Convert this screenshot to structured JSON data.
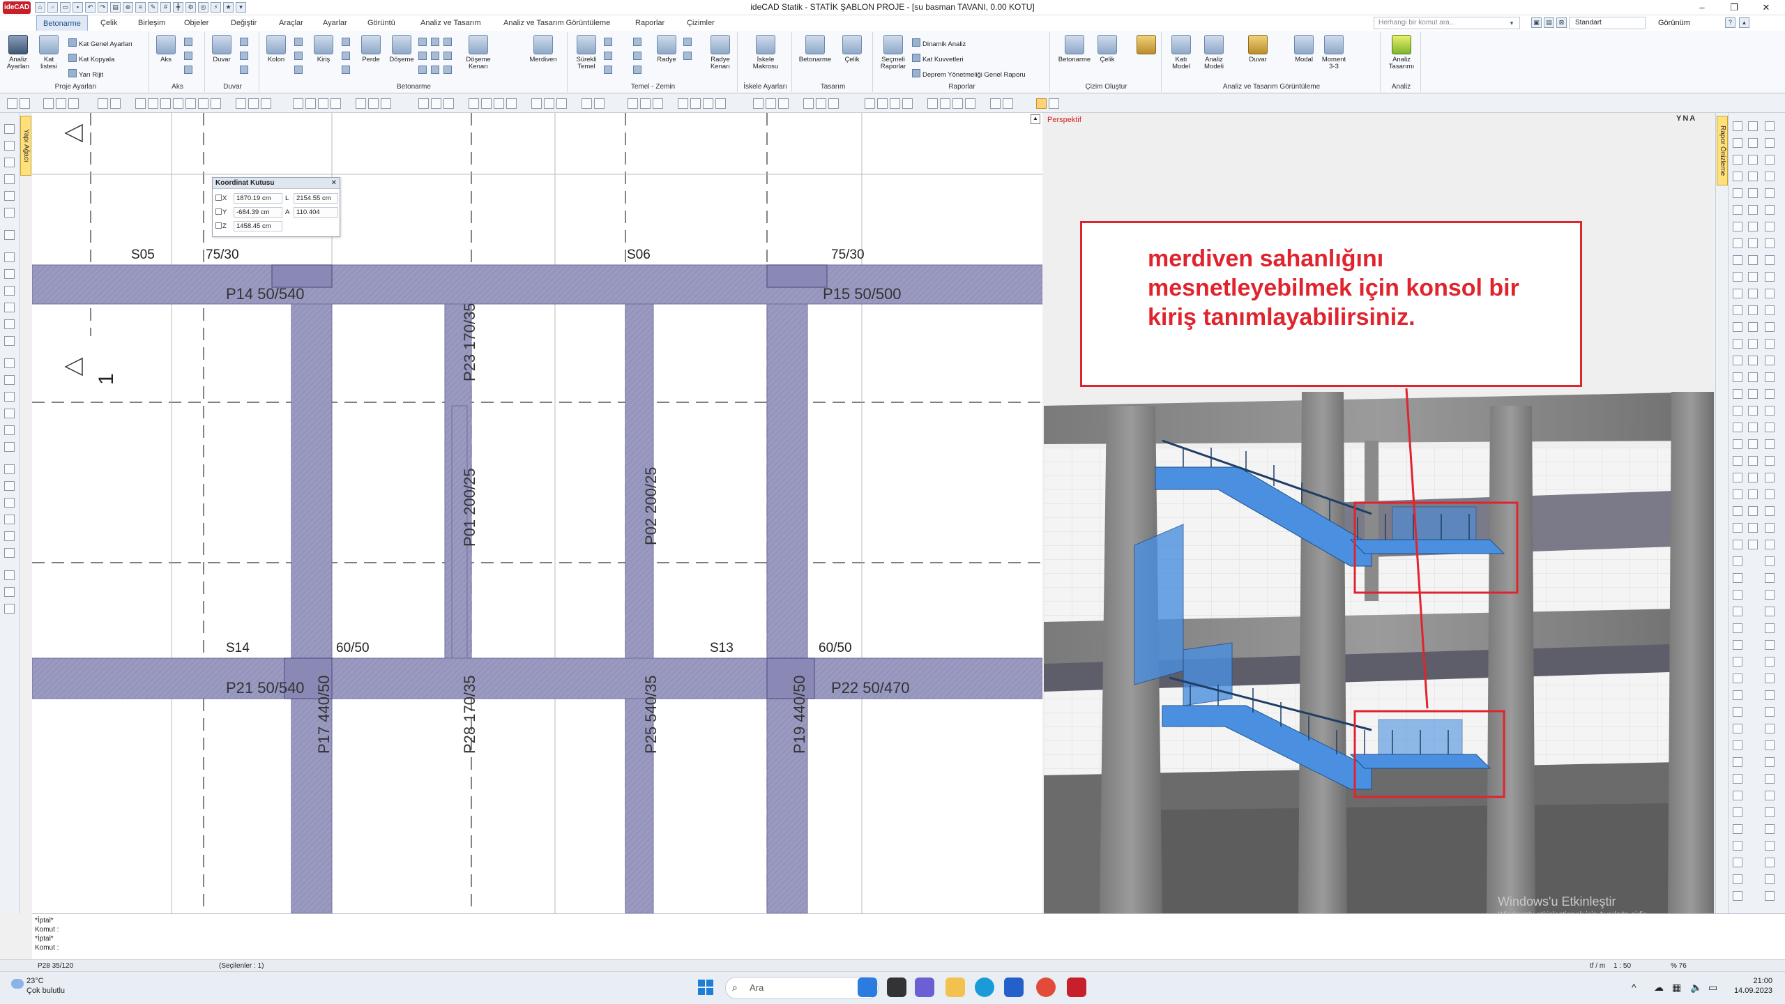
{
  "app": {
    "logo": "ideCAD",
    "title": "ideCAD Statik - STATİK ŞABLON PROJE - [su basman TAVANI,  0.00 KOTU]"
  },
  "window": {
    "minimize": "–",
    "maximize": "❐",
    "close": "✕"
  },
  "menu": {
    "tabs": [
      "Betonarme",
      "Çelik",
      "Birleşim",
      "Objeler",
      "Değiştir",
      "Araçlar",
      "Ayarlar",
      "Görüntü",
      "Analiz ve Tasarım",
      "Analiz ve Tasarım Görüntüleme",
      "Raporlar",
      "Çizimler"
    ],
    "search_placeholder": "Herhangi bir komut ara...",
    "standard": "Standart",
    "view": "Görünüm"
  },
  "ribbon": {
    "groups": [
      "Proje Ayarları",
      "Aks",
      "Duvar",
      "Betonarme",
      "Temel - Zemin",
      "İskele Ayarları",
      "Tasarım",
      "Raporlar",
      "Çizim Oluştur",
      "Analiz ve Tasarım Görüntüleme",
      "Analiz"
    ],
    "proj": {
      "analiz": "Analiz Ayarları",
      "kat": "Kat listesi",
      "s1": "Kat Genel Ayarları",
      "s2": "Kat Kopyala",
      "s3": "Yarı Rijit"
    },
    "aks": "Aks",
    "duvar": "Duvar",
    "beton": {
      "kolon": "Kolon",
      "kiris": "Kiriş",
      "perde": "Perde",
      "doseme": "Döşeme",
      "doseme_kenari": "Döşeme Kenarı",
      "merdiven": "Merdiven"
    },
    "temel": {
      "surekli": "Sürekli Temel",
      "radye": "Radye",
      "radye_kenari": "Radye Kenarı"
    },
    "iskele": "İskele Makrosu",
    "tasarim": {
      "betonarme": "Betonarme",
      "celik": "Çelik"
    },
    "raporlar": {
      "secmeli": "Seçmeli Raporlar",
      "s1": "Dinamik Analiz",
      "s2": "Kat Kuvvetleri",
      "s3": "Deprem Yönetmeliği Genel Raporu"
    },
    "cizim": {
      "betonarme": "Betonarme",
      "celik": "Çelik"
    },
    "atg": {
      "kati": "Katı Model",
      "analiz": "Analiz Modeli",
      "duvar": "Duvar",
      "modal": "Modal",
      "moment": "Moment 3-3"
    },
    "analiz": "Analiz Tasarımı"
  },
  "left": {
    "yapi": "Yapı Ağacı"
  },
  "plan": {
    "labels": {
      "s05": "S05",
      "s05dim": "75/30",
      "s06": "S06",
      "s06dim": "75/30",
      "s14": "S14",
      "s14dim": "60/50",
      "s13": "S13",
      "s13dim": "60/50",
      "p14": "P14 50/540",
      "p15": "P15 50/500",
      "p21": "P21 50/540",
      "p22": "P22 50/470",
      "p23": "P23 170/35",
      "p01": "P01 200/25",
      "p02": "P02 200/25",
      "p17": "P17 440/50",
      "p28": "P28 170/35",
      "p25": "P25 540/35",
      "p19": "P19 440/50",
      "axis": "1"
    },
    "colors": {
      "beam": "#9a99c0",
      "edge": "#6f6e9c"
    }
  },
  "coord": {
    "title": "Koordinat Kutusu",
    "x_label": "X",
    "x": "1870.19 cm",
    "l_label": "L",
    "l": "2154.55 cm",
    "y_label": "Y",
    "y": "-684.39 cm",
    "a_label": "A",
    "a": "110.404",
    "z_label": "Z",
    "z": "1458.45 cm"
  },
  "view3d": {
    "perspective": "Perspektif",
    "cube": "YNA",
    "callout": "merdiven sahanlığını mesnetleyebilmek için konsol bir kiriş tanımlayabilirsiniz.",
    "wm1": "Windows'u Etkinleştir",
    "wm2": "Windows'u etkinleştirmek için Ayarlar'a gidin.",
    "accent": "#e0242e",
    "stair": "#4a8fe0"
  },
  "right": {
    "rapor": "Rapor Önizleme"
  },
  "command": {
    "lines": [
      "*İptal*",
      "Komut :",
      "*İptal*",
      "Komut :"
    ]
  },
  "status": {
    "item": "P28 35/120",
    "selected": "(Seçilenler : 1)",
    "unit": "tf / m",
    "scale": "1 : 50",
    "zoom": "% 76"
  },
  "taskbar": {
    "temp": "23°C",
    "weather": "Çok bulutlu",
    "search": "Ara",
    "time": "21:00",
    "date": "14.09.2023"
  }
}
